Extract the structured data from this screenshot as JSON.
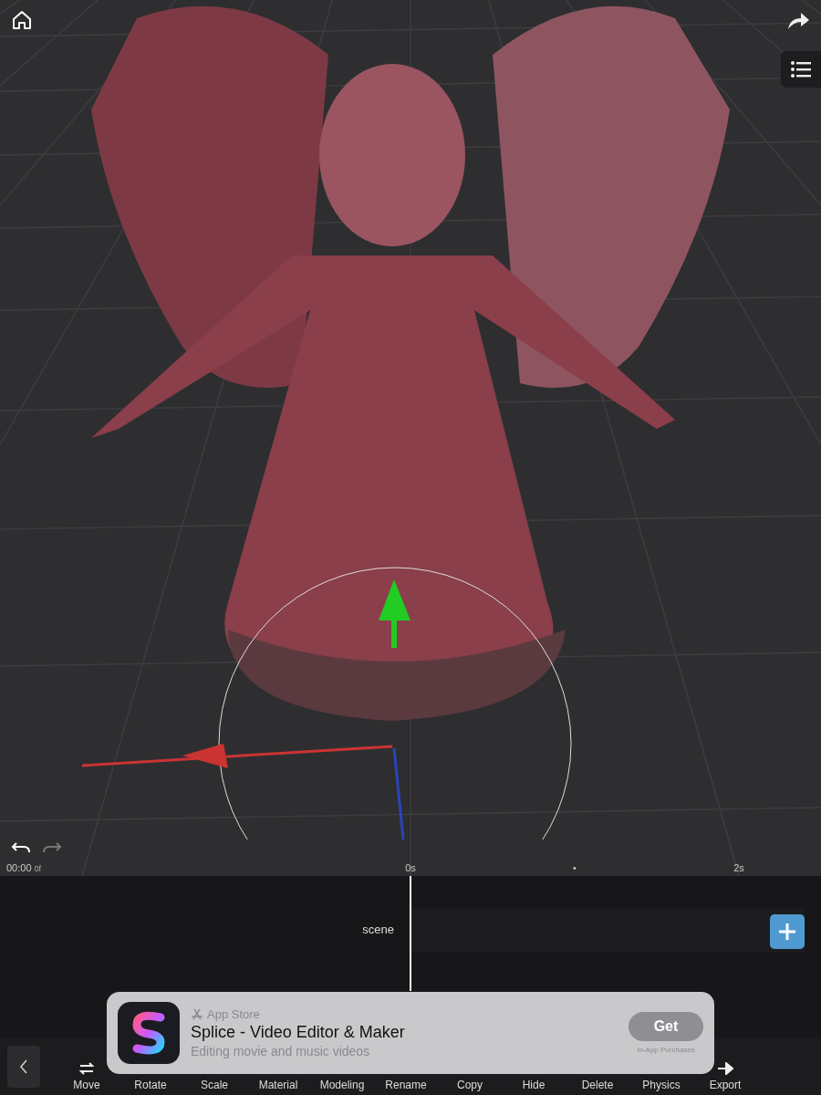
{
  "ruler": {
    "timecode": "00:00",
    "frame": "0f",
    "ticks": [
      "0s",
      "•",
      "2s"
    ]
  },
  "timeline": {
    "track": "scene"
  },
  "toolbar": {
    "tools": [
      "Move",
      "Rotate",
      "Scale",
      "Material",
      "Modeling",
      "Rename",
      "Copy",
      "Hide",
      "Delete",
      "Physics",
      "Export"
    ]
  },
  "ad_banner": {
    "source": "App Store",
    "title": "Splice - Video Editor & Maker",
    "subtitle": "Editing movie and music videos",
    "button": "Get",
    "note": "In-App Purchases"
  }
}
